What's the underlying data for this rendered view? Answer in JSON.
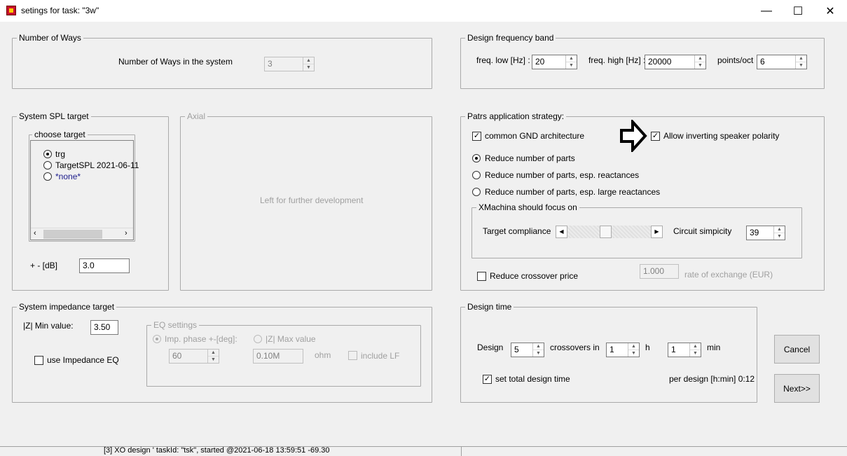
{
  "window": {
    "title": "setings for task: \"3w\"",
    "minimize": "—",
    "maximize": "☐",
    "close": "✕"
  },
  "ways": {
    "caption": "Number of Ways",
    "label": "Number of Ways in the system",
    "value": "3"
  },
  "freq": {
    "caption": "Design frequency band",
    "low_label": "freq. low [Hz] :",
    "low_value": "20",
    "high_label": "freq. high [Hz] :",
    "high_value": "20000",
    "pts_label": "points/oct",
    "pts_value": "6"
  },
  "spl": {
    "caption": "System SPL target",
    "choose_caption": "choose target",
    "options": [
      "trg",
      "TargetSPL 2021-06-11",
      "*none*"
    ],
    "tol_label": "+ - [dB]",
    "tol_value": "3.0"
  },
  "axial": {
    "caption": "Axial",
    "placeholder": "Left for further development"
  },
  "strategy": {
    "caption": "Patrs application strategy:",
    "common_gnd": "common GND architecture",
    "allow_invert": "Allow inverting speaker polarity",
    "reduce_parts": "Reduce number of parts",
    "reduce_react": "Reduce number of parts, esp. reactances",
    "reduce_large": "Reduce number of parts, esp. large reactances",
    "focus_caption": "XMachina should focus on",
    "target_compliance": "Target compliance",
    "circuit_simplicity": "Circuit simpicity",
    "simplicity_value": "39",
    "slider_level": 0.45,
    "reduce_price": "Reduce crossover price",
    "rate_value": "1.000",
    "rate_label": "rate of exchange (EUR)"
  },
  "impedance": {
    "caption": "System impedance target",
    "min_label": "|Z| Min value:",
    "min_value": "3.50",
    "use_eq": "use Impedance EQ",
    "eq_caption": "EQ settings",
    "imp_phase": "Imp. phase +-[deg]:",
    "phase_value": "60",
    "zmax": "|Z| Max value",
    "zmax_value": "0.10M",
    "ohm": "ohm",
    "include_lf": "include LF"
  },
  "design_time": {
    "caption": "Design time",
    "design_label": "Design",
    "design_value": "5",
    "crossovers_label": "crossovers in",
    "hours_value": "1",
    "h": "h",
    "min_value": "1",
    "min": "min",
    "set_total": "set total design time",
    "per_design": "per design [h:min] 0:12"
  },
  "buttons": {
    "cancel": "Cancel",
    "next": "Next>>"
  },
  "status": {
    "text": "[3] XO design ' taskId: \"tsk\", started @2021-06-18 13:59:51 -69.30"
  }
}
